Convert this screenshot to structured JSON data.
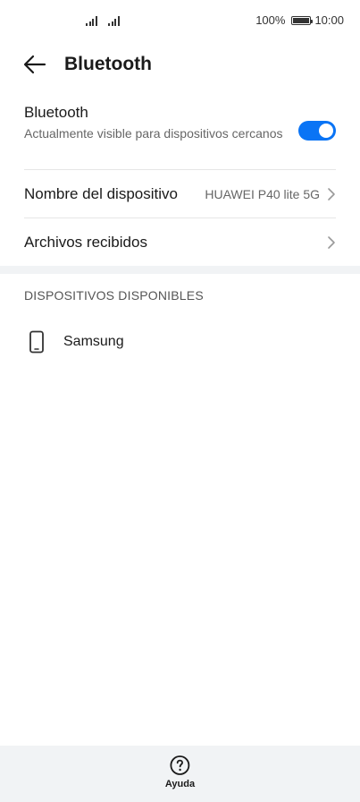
{
  "status_bar": {
    "battery_percent": "100%",
    "time": "10:00",
    "icons": [
      "signal-icon",
      "signal-icon",
      "battery-icon"
    ]
  },
  "app_bar": {
    "back_icon": "arrow-left-icon",
    "title": "Bluetooth"
  },
  "bluetooth": {
    "label": "Bluetooth",
    "subtitle": "Actualmente visible para dispositivos cercanos",
    "enabled": true,
    "accent_color": "#0a74f5"
  },
  "device_name_row": {
    "label": "Nombre del dispositivo",
    "value": "HUAWEI P40 lite 5G"
  },
  "received_files_row": {
    "label": "Archivos recibidos"
  },
  "available_devices": {
    "header": "DISPOSITIVOS DISPONIBLES",
    "items": [
      {
        "icon": "phone-icon",
        "name": "Samsung"
      }
    ]
  },
  "bottom_bar": {
    "help_icon": "question-circle-icon",
    "help_label": "Ayuda"
  }
}
